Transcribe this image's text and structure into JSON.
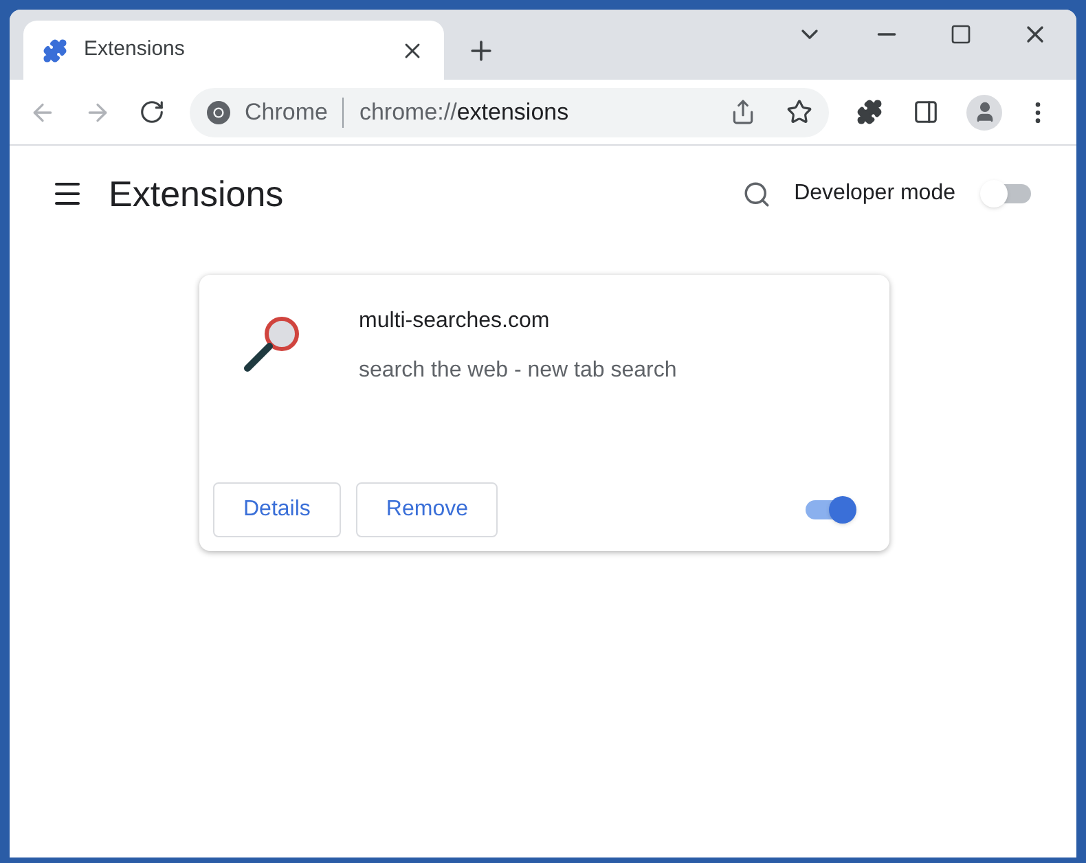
{
  "tab": {
    "title": "Extensions",
    "selected": true
  },
  "omnibox": {
    "site_label": "Chrome",
    "url_scheme": "chrome://",
    "url_path": "extensions"
  },
  "page": {
    "title": "Extensions",
    "developer_mode": {
      "label": "Developer mode",
      "on": false
    }
  },
  "extensions": [
    {
      "name": "multi-searches.com",
      "description": "search the web - new tab search",
      "buttons": [
        "Details",
        "Remove"
      ],
      "on": true
    }
  ]
}
